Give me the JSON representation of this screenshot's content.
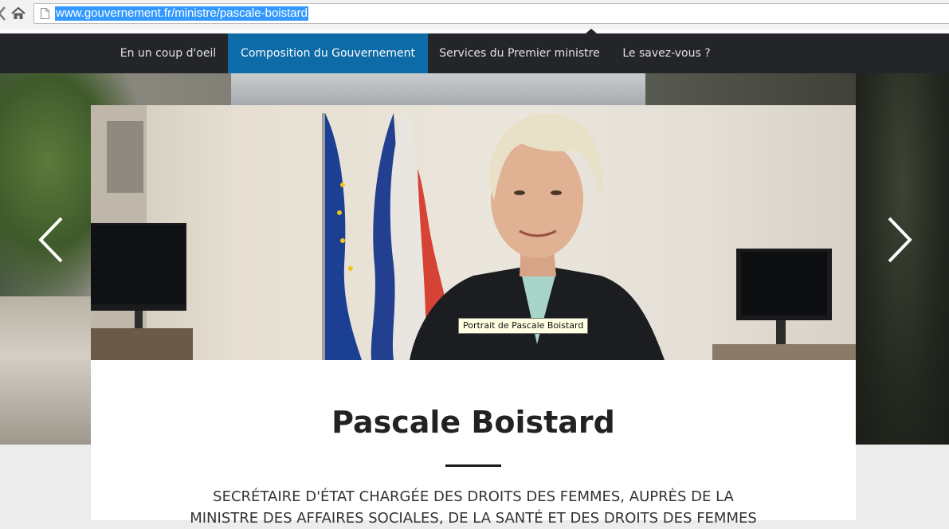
{
  "browser": {
    "url": "www.gouvernement.fr/ministre/pascale-boistard",
    "icons": [
      "back-arrow-icon",
      "home-icon",
      "page-icon"
    ]
  },
  "nav": {
    "items": [
      {
        "label": "En un coup d'oeil",
        "active": false
      },
      {
        "label": "Composition du Gouvernement",
        "active": true
      },
      {
        "label": "Services du Premier ministre",
        "active": false
      },
      {
        "label": "Le savez-vous ?",
        "active": false
      }
    ],
    "background": "#232529",
    "active_color": "#0d6ca8"
  },
  "carousel": {
    "prev_icon": "chevron-left-icon",
    "next_icon": "chevron-right-icon"
  },
  "photo": {
    "tooltip": "Portrait de Pascale Boistard"
  },
  "minister": {
    "name": "Pascale Boistard",
    "role_line1": "SECRÉTAIRE D'ÉTAT CHARGÉE DES DROITS DES FEMMES, AUPRÈS DE LA",
    "role_line2": "MINISTRE DES AFFAIRES SOCIALES, DE LA SANTÉ ET DES DROITS DES FEMMES"
  }
}
